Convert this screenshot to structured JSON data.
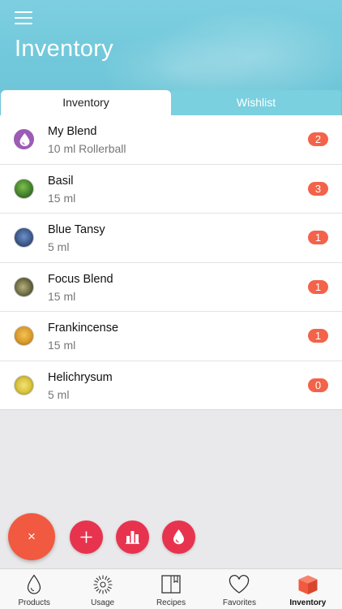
{
  "header": {
    "title": "Inventory",
    "menu_icon": "hamburger-menu-icon"
  },
  "tabs": [
    {
      "label": "Inventory",
      "active": true
    },
    {
      "label": "Wishlist",
      "active": false
    }
  ],
  "items": [
    {
      "name": "My Blend",
      "size": "10 ml Rollerball",
      "count": "2",
      "thumb": "drop",
      "color": "#9c5bb5"
    },
    {
      "name": "Basil",
      "size": "15 ml",
      "count": "3",
      "thumb": "photo",
      "color": "#3d7a2a"
    },
    {
      "name": "Blue Tansy",
      "size": "5 ml",
      "count": "1",
      "thumb": "photo",
      "color": "#3d5a8a"
    },
    {
      "name": "Focus Blend",
      "size": "15 ml",
      "count": "1",
      "thumb": "photo",
      "color": "#6b6a45"
    },
    {
      "name": "Frankincense",
      "size": "15 ml",
      "count": "1",
      "thumb": "photo",
      "color": "#d99a2a"
    },
    {
      "name": "Helichrysum",
      "size": "5 ml",
      "count": "0",
      "thumb": "photo",
      "color": "#d9c23a"
    }
  ],
  "fab": {
    "close_label": "×",
    "actions": [
      "add-icon",
      "bar-chart-icon",
      "drop-icon"
    ]
  },
  "tabbar": [
    {
      "label": "Products",
      "icon": "drop-outline-icon",
      "active": false
    },
    {
      "label": "Usage",
      "icon": "flower-icon",
      "active": false
    },
    {
      "label": "Recipes",
      "icon": "book-icon",
      "active": false
    },
    {
      "label": "Favorites",
      "icon": "heart-icon",
      "active": false
    },
    {
      "label": "Inventory",
      "icon": "box-icon",
      "active": true
    }
  ],
  "colors": {
    "header": "#72c9db",
    "badge": "#f2634a",
    "fab_main": "#f15a40",
    "fab_secondary": "#e8334f",
    "inventory_active_icon": "#f15a40"
  }
}
